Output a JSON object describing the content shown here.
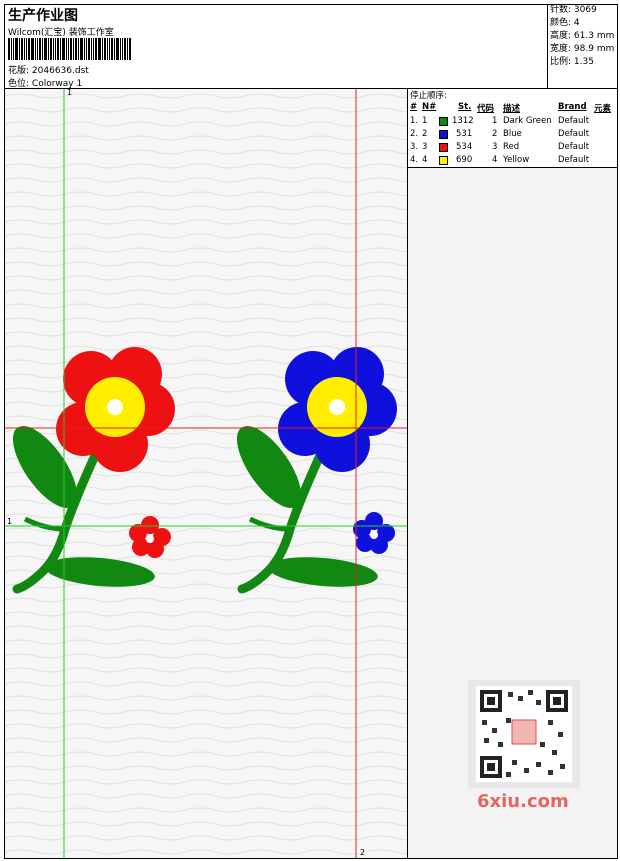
{
  "header": {
    "title": "生产作业图",
    "studio": "Wilcom(汇宝) 装饰工作室",
    "design_label": "花版:",
    "design_value": "2046636.dst",
    "colorway_label": "色位:",
    "colorway_value": "Colorway 1"
  },
  "stats": [
    {
      "label": "针数:",
      "value": "3069"
    },
    {
      "label": "颜色:",
      "value": "4"
    },
    {
      "label": "高度:",
      "value": "61.3 mm"
    },
    {
      "label": "宽度:",
      "value": "98.9 mm"
    },
    {
      "label": "比例:",
      "value": "1.35"
    }
  ],
  "stop_sequence": {
    "title": "停止顺序:",
    "headers": {
      "index": "#",
      "needle": "N#",
      "stitches": "St.",
      "code": "代码",
      "description": "描述",
      "brand": "Brand",
      "element": "元素"
    },
    "rows": [
      {
        "index": "1.",
        "needle": "1",
        "color": "#118811",
        "stitches": "1312",
        "code": "1",
        "description": "Dark Green",
        "brand": "Default"
      },
      {
        "index": "2.",
        "needle": "2",
        "color": "#1010dd",
        "stitches": "531",
        "code": "2",
        "description": "Blue",
        "brand": "Default"
      },
      {
        "index": "3.",
        "needle": "3",
        "color": "#ee1111",
        "stitches": "534",
        "code": "3",
        "description": "Red",
        "brand": "Default"
      },
      {
        "index": "4.",
        "needle": "4",
        "color": "#ffee00",
        "stitches": "690",
        "code": "4",
        "description": "Yellow",
        "brand": "Default"
      }
    ]
  },
  "guides": {
    "top_label": "1",
    "left_label": "1",
    "bottom_label": "2"
  },
  "watermark": {
    "logo_text": "6xiu.com"
  },
  "colors": {
    "green": "#118811",
    "blue": "#1010dd",
    "red": "#ee1111",
    "yellow": "#ffee00",
    "guide_green": "#22cc22",
    "guide_red": "#dd2222"
  }
}
